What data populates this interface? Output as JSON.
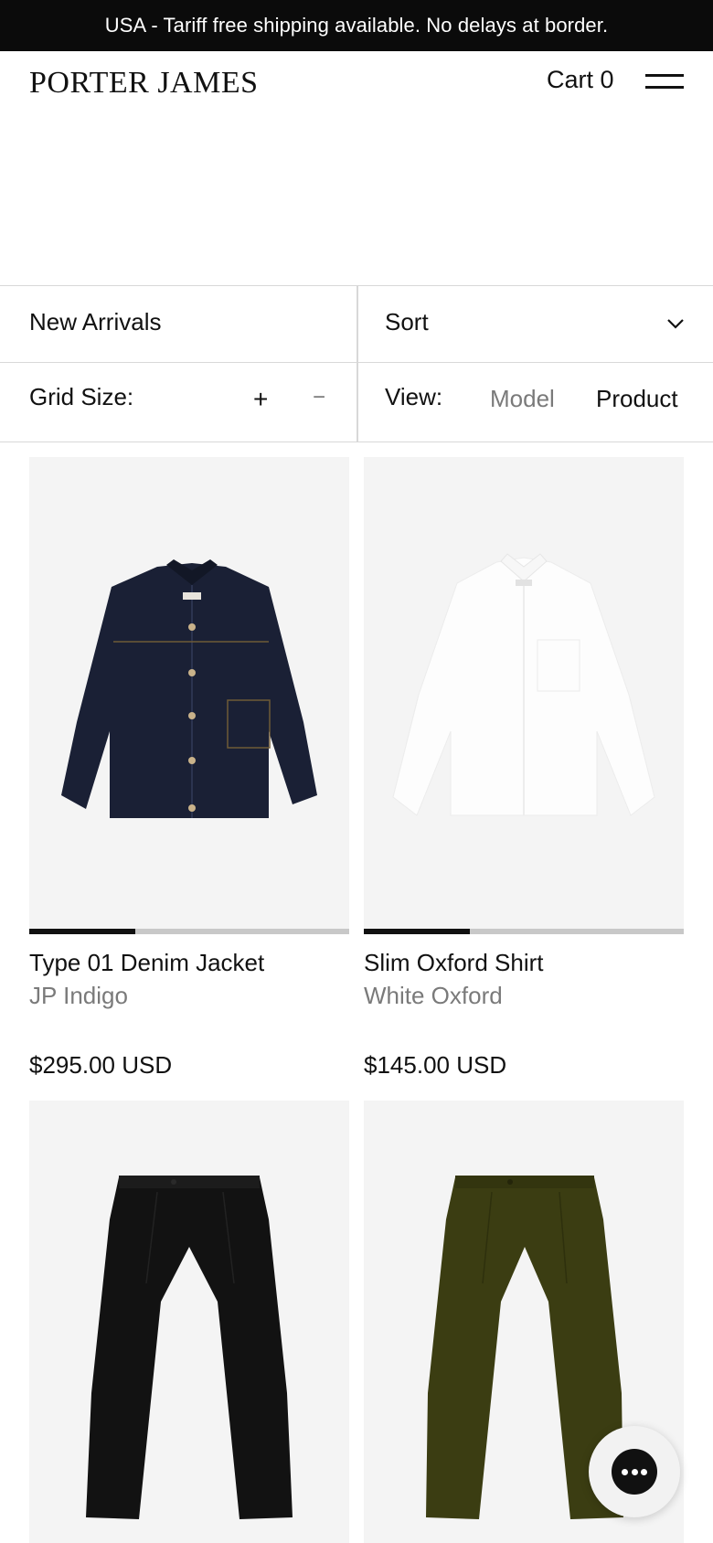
{
  "announcement": {
    "text": "USA - Tariff free shipping available. No delays at border."
  },
  "header": {
    "logo": "PORTER JAMES",
    "cart_label": "Cart 0",
    "menu_icon": "hamburger-icon"
  },
  "filters": {
    "collection": "New Arrivals",
    "sort_label": "Sort",
    "sort_icon": "chevron-down-icon",
    "grid_size_label": "Grid Size:",
    "grid_plus": "+",
    "grid_minus": "−",
    "view_label": "View:",
    "view_model": "Model",
    "view_product": "Product"
  },
  "products": [
    {
      "name": "Type 01 Denim Jacket",
      "color": "JP Indigo",
      "price": "$295.00 USD",
      "swatch": "#1a2035",
      "image_icon": "denim-jacket-image",
      "image_progress": 0.33
    },
    {
      "name": "Slim Oxford Shirt",
      "color": "White Oxford",
      "price": "$145.00 USD",
      "swatch": "#ffffff",
      "image_icon": "oxford-shirt-image",
      "image_progress": 0.33
    },
    {
      "name": "",
      "color": "",
      "price": "",
      "swatch": "#121212",
      "image_icon": "black-trousers-image"
    },
    {
      "name": "",
      "color": "",
      "price": "",
      "swatch": "#3b3d12",
      "image_icon": "olive-trousers-image"
    }
  ],
  "chat": {
    "icon": "chat-icon"
  },
  "colors": {
    "announcement_bg": "#0b0b0b",
    "card_bg": "#f4f4f4",
    "muted_text": "#7a7a7a"
  }
}
